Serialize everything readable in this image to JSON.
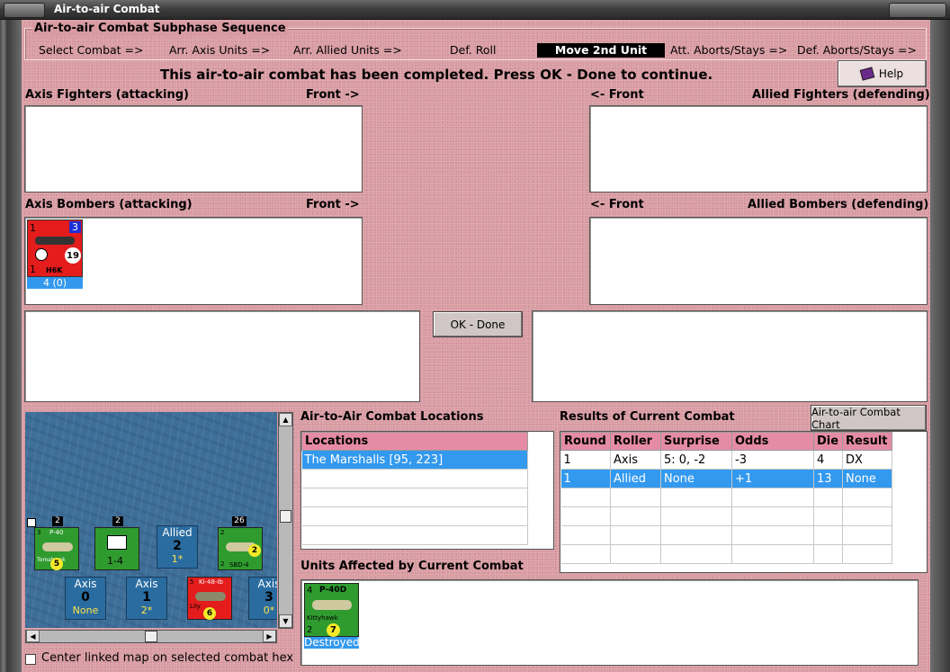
{
  "window": {
    "title": "Air-to-air Combat"
  },
  "sequence": {
    "title": "Air-to-air Combat Subphase Sequence",
    "steps": [
      "Select Combat =>",
      "Arr. Axis Units =>",
      "Arr. Allied Units =>",
      "Def. Roll",
      "Move 2nd Unit",
      "Att. Aborts/Stays =>",
      "Def. Aborts/Stays =>"
    ],
    "active_step": "Move 2nd Unit"
  },
  "status_message": "This air-to-air combat has been completed.  Press OK - Done to continue.",
  "help_button": "Help",
  "panels": {
    "axis_fighters": {
      "label": "Axis Fighters (attacking)",
      "front": "Front ->"
    },
    "allied_fighters": {
      "label": "Allied Fighters (defending)",
      "front": "<- Front"
    },
    "axis_bombers": {
      "label": "Axis Bombers (attacking)",
      "front": "Front ->"
    },
    "allied_bombers": {
      "label": "Allied Bombers (defending)",
      "front": "<- Front"
    }
  },
  "axis_bomber_unit": {
    "name": "H6K",
    "top_left": "1",
    "top_right": "3",
    "mid_right": "19",
    "bottom_left": "1",
    "strength_label": "4 (0)",
    "color": "#e41c1c"
  },
  "ok_button": "OK - Done",
  "locations": {
    "title": "Air-to-Air Combat Locations",
    "header": "Locations",
    "rows": [
      "The Marshalls [95, 223]",
      "",
      "",
      "",
      "",
      ""
    ]
  },
  "results": {
    "title": "Results of Current Combat",
    "chart_button": "Air-to-air Combat Chart",
    "headers": [
      "Round",
      "Roller",
      "Surprise",
      "Odds",
      "Die",
      "Result"
    ],
    "rows": [
      [
        "1",
        "Axis",
        "5: 0, -2",
        "-3",
        "4",
        "DX"
      ],
      [
        "1",
        "Allied",
        "None",
        "+1",
        "13",
        "None"
      ],
      [
        "",
        "",
        "",
        "",
        "",
        ""
      ],
      [
        "",
        "",
        "",
        "",
        "",
        ""
      ],
      [
        "",
        "",
        "",
        "",
        "",
        ""
      ],
      [
        "",
        "",
        "",
        "",
        "",
        ""
      ]
    ]
  },
  "affected": {
    "title": "Units Affected by Current Combat",
    "unit": {
      "name": "P-40D",
      "sub": "Kittyhawk",
      "top_left": "4",
      "bottom_left": "2",
      "die": "7",
      "status": "Destroyed"
    }
  },
  "map": {
    "counters": [
      {
        "name": "P-40",
        "sub": "Tomahawk",
        "tl": "3",
        "bl": "2",
        "die": "5",
        "stack": "2"
      },
      {
        "name": "",
        "sub": "",
        "tl": "",
        "bl": "",
        "die": "",
        "label": "1-4",
        "stack": "2"
      },
      {
        "name": "SBD-4",
        "sub": "",
        "tl": "2",
        "bl": "2",
        "die": "2",
        "stack": "26"
      },
      {
        "name": "Ki-48-Ib",
        "sub": "Lily",
        "tl": "5",
        "bl": "",
        "die": "6",
        "stack": ""
      }
    ],
    "stacks": [
      {
        "side": "Allied",
        "count": "2",
        "sub": "1*"
      },
      {
        "side": "Axis",
        "count": "0",
        "sub": "None"
      },
      {
        "side": "Axis",
        "count": "1",
        "sub": "2*"
      },
      {
        "side": "Axis",
        "count": "3",
        "sub": "0*"
      }
    ]
  },
  "center_map_label": "Center linked map on selected combat hex",
  "colors": {
    "background": "#d89ba2",
    "header": "#e58ba6",
    "selection": "#3399ee",
    "axis_unit": "#e41c1c",
    "allied_unit": "#2f9b2f"
  }
}
